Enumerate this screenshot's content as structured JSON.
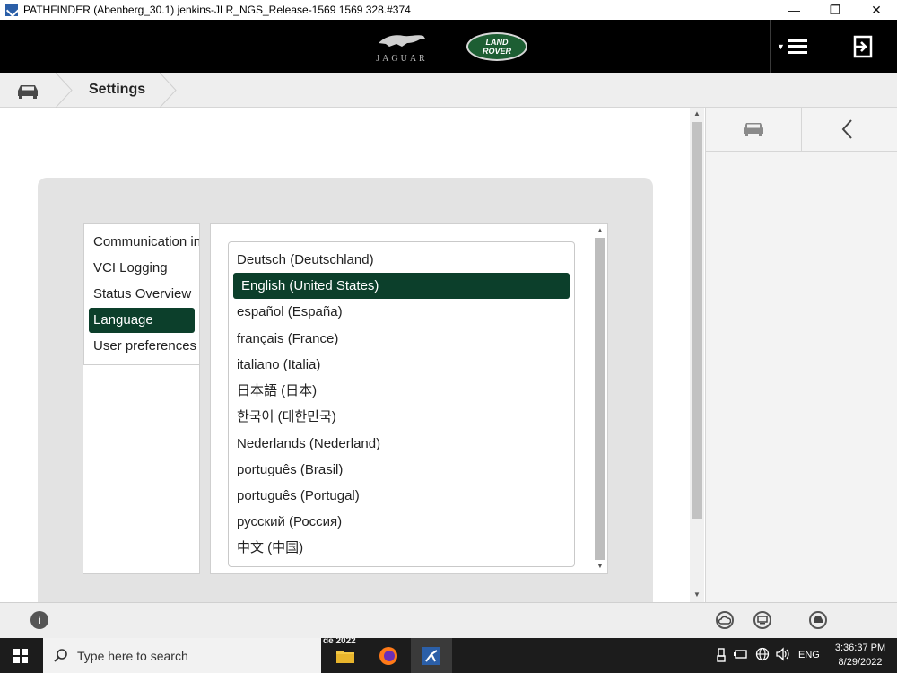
{
  "window": {
    "title": "PATHFINDER (Abenberg_30.1) jenkins-JLR_NGS_Release-1569 1569 328.#374",
    "minimize": "—",
    "restore": "❐",
    "close": "✕"
  },
  "brand": {
    "jaguar": "JAGUAR",
    "landrover_line1": "LAND",
    "landrover_line2": "ROVER"
  },
  "breadcrumb": {
    "current": "Settings"
  },
  "settings_nav": {
    "items": [
      {
        "label": "Communication interface",
        "selected": false
      },
      {
        "label": "VCI Logging",
        "selected": false
      },
      {
        "label": "Status Overview",
        "selected": false
      },
      {
        "label": "Language",
        "selected": true
      },
      {
        "label": "User preferences",
        "selected": false
      }
    ]
  },
  "languages": {
    "items": [
      {
        "label": "Deutsch (Deutschland)",
        "selected": false
      },
      {
        "label": "English (United States)",
        "selected": true
      },
      {
        "label": "español (España)",
        "selected": false
      },
      {
        "label": "français (France)",
        "selected": false
      },
      {
        "label": "italiano (Italia)",
        "selected": false
      },
      {
        "label": "日本語 (日本)",
        "selected": false
      },
      {
        "label": "한국어 (대한민국)",
        "selected": false
      },
      {
        "label": "Nederlands (Nederland)",
        "selected": false
      },
      {
        "label": "português (Brasil)",
        "selected": false
      },
      {
        "label": "português (Portugal)",
        "selected": false
      },
      {
        "label": "русский (Россия)",
        "selected": false
      },
      {
        "label": "中文 (中国)",
        "selected": false
      }
    ]
  },
  "statusbar": {
    "info_icon": "i"
  },
  "taskbar": {
    "search_placeholder": "Type here to search",
    "app_label": "de 2022",
    "tray_lang": "ENG",
    "time": "3:36:37 PM",
    "date": "8/29/2022"
  },
  "colors": {
    "selected_green": "#0c3f2b",
    "header_black": "#000000",
    "landrover_green": "#1d5e33"
  }
}
